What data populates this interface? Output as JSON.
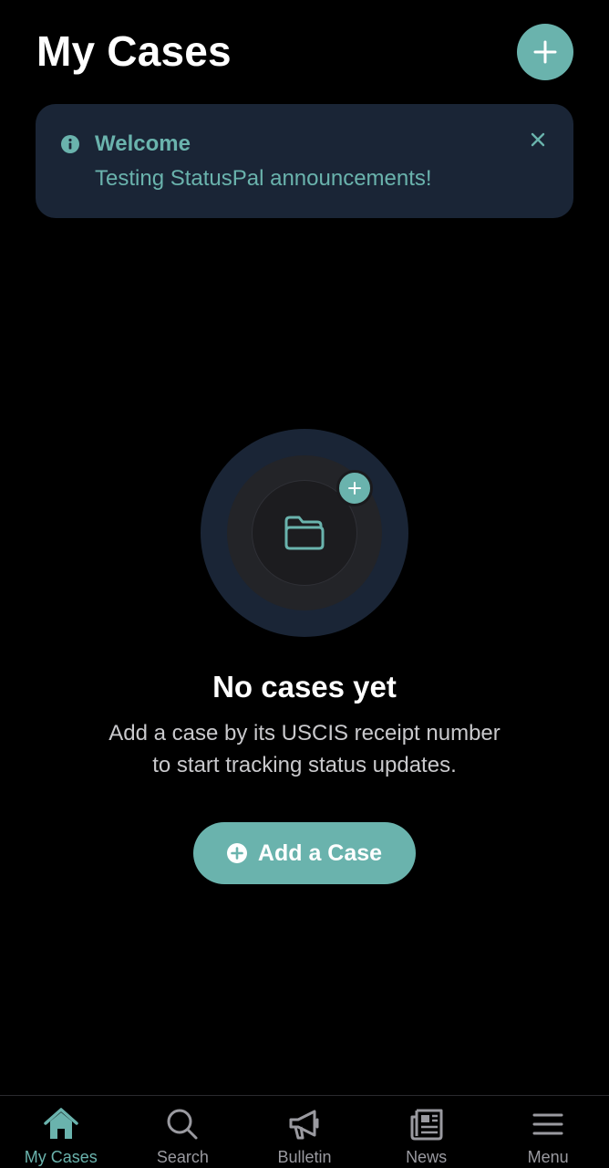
{
  "header": {
    "title": "My Cases"
  },
  "announcement": {
    "title": "Welcome",
    "message": "Testing StatusPal announcements!"
  },
  "empty_state": {
    "title": "No cases yet",
    "description_line1": "Add a case by its USCIS receipt number",
    "description_line2": "to start tracking status updates.",
    "button_label": "Add a Case"
  },
  "nav": {
    "items": [
      {
        "label": "My Cases",
        "icon": "home-icon",
        "active": true
      },
      {
        "label": "Search",
        "icon": "search-icon",
        "active": false
      },
      {
        "label": "Bulletin",
        "icon": "megaphone-icon",
        "active": false
      },
      {
        "label": "News",
        "icon": "newspaper-icon",
        "active": false
      },
      {
        "label": "Menu",
        "icon": "menu-icon",
        "active": false
      }
    ]
  },
  "colors": {
    "accent": "#6ab3ad",
    "card_bg": "#1a2536",
    "background": "#000000",
    "inactive_nav": "#9a9aa0"
  }
}
